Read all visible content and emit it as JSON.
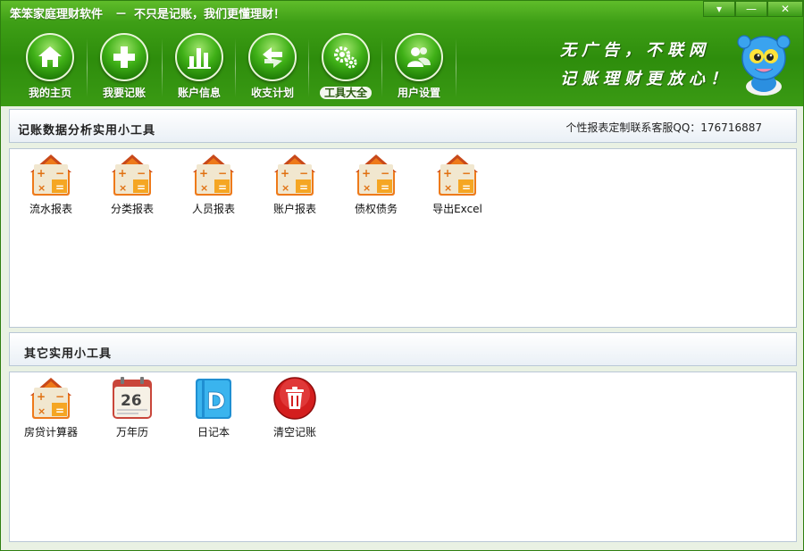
{
  "window": {
    "app_name": "笨笨家庭理财软件",
    "separator": "－",
    "tagline": "不只是记账，我们更懂理财！",
    "controls": [
      "▾",
      "—",
      "✕"
    ]
  },
  "nav": {
    "items": [
      {
        "label": "我的主页",
        "icon": "home-icon"
      },
      {
        "label": "我要记账",
        "icon": "plus-icon"
      },
      {
        "label": "账户信息",
        "icon": "bar-chart-icon"
      },
      {
        "label": "收支计划",
        "icon": "arrows-exchange-icon"
      },
      {
        "label": "工具大全",
        "icon": "gears-icon",
        "active": true
      },
      {
        "label": "用户设置",
        "icon": "users-icon"
      }
    ]
  },
  "slogan": {
    "line1": "无广告，不联网",
    "line2": "记账理财更放心！"
  },
  "section_analysis": {
    "title": "记账数据分析实用小工具",
    "contact": "个性报表定制联系客服QQ：176716887",
    "tools": [
      {
        "label": "流水报表",
        "icon": "calculator-house-icon"
      },
      {
        "label": "分类报表",
        "icon": "calculator-house-icon"
      },
      {
        "label": "人员报表",
        "icon": "calculator-house-icon"
      },
      {
        "label": "账户报表",
        "icon": "calculator-house-icon"
      },
      {
        "label": "债权债务",
        "icon": "calculator-house-icon"
      },
      {
        "label": "导出Excel",
        "icon": "calculator-house-icon"
      }
    ]
  },
  "section_other": {
    "title": "其它实用小工具",
    "tools": [
      {
        "label": "房贷计算器",
        "icon": "calculator-house-icon"
      },
      {
        "label": "万年历",
        "icon": "calendar-icon",
        "day": "26"
      },
      {
        "label": "日记本",
        "icon": "diary-icon",
        "letter": "D"
      },
      {
        "label": "清空记账",
        "icon": "trash-icon"
      }
    ]
  },
  "colors": {
    "brand_green": "#3e9f16",
    "calc_orange": "#ee7a1a",
    "trash_red": "#d41e1e",
    "diary_blue": "#27a4e0"
  }
}
